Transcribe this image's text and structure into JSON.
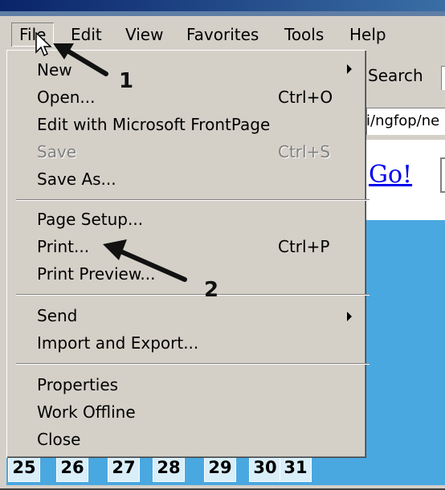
{
  "menubar": {
    "items": [
      {
        "label": "File"
      },
      {
        "label": "Edit"
      },
      {
        "label": "View"
      },
      {
        "label": "Favorites"
      },
      {
        "label": "Tools"
      },
      {
        "label": "Help"
      }
    ]
  },
  "file_menu": {
    "new": {
      "label": "New"
    },
    "open": {
      "label": "Open...",
      "shortcut": "Ctrl+O"
    },
    "edit_frontpage": {
      "label": "Edit with Microsoft FrontPage"
    },
    "save": {
      "label": "Save",
      "shortcut": "Ctrl+S",
      "enabled": false
    },
    "save_as": {
      "label": "Save As..."
    },
    "page_setup": {
      "label": "Page Setup..."
    },
    "print": {
      "label": "Print...",
      "shortcut": "Ctrl+P"
    },
    "print_preview": {
      "label": "Print Preview..."
    },
    "send": {
      "label": "Send"
    },
    "import_export": {
      "label": "Import and Export..."
    },
    "properties": {
      "label": "Properties"
    },
    "work_offline": {
      "label": "Work Offline"
    },
    "close": {
      "label": "Close"
    }
  },
  "toolbar": {
    "search_label": "Search"
  },
  "address": {
    "value": "i/ngfop/ne"
  },
  "page": {
    "go_link": "Go!",
    "calendar_days": [
      "25",
      "26",
      "27",
      "28",
      "29",
      "30",
      "31"
    ]
  },
  "annotations": {
    "step1": "1",
    "step2": "2"
  },
  "colors": {
    "menu_background": "#d4d0c8",
    "page_background": "#4aa8e0",
    "link": "#0000ee"
  }
}
